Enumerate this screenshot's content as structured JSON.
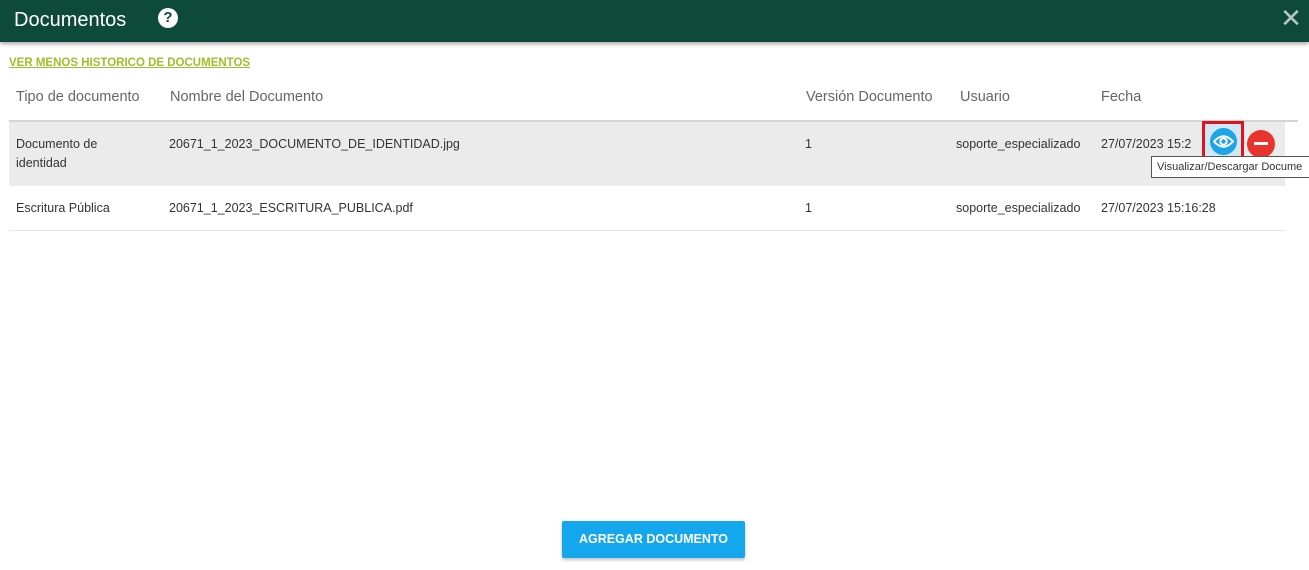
{
  "header": {
    "title": "Documentos",
    "help_icon": "?",
    "close_icon": "✕"
  },
  "history_link": "VER MENOS HISTORICO DE DOCUMENTOS",
  "table": {
    "columns": [
      "Tipo de documento",
      "Nombre del Documento",
      "Versión Documento",
      "Usuario",
      "Fecha"
    ],
    "rows": [
      {
        "tipo": "Documento de identidad",
        "nombre": "20671_1_2023_DOCUMENTO_DE_IDENTIDAD.jpg",
        "version": "1",
        "usuario": "soporte_especializado",
        "fecha": "27/07/2023 15:2"
      },
      {
        "tipo": "Escritura Pública",
        "nombre": "20671_1_2023_ESCRITURA_PUBLICA.pdf",
        "version": "1",
        "usuario": "soporte_especializado",
        "fecha": "27/07/2023 15:16:28"
      }
    ]
  },
  "tooltip": "Visualizar/Descargar Docume",
  "add_button": "AGREGAR DOCUMENTO",
  "colors": {
    "header_bg": "#0d4a3a",
    "link": "#9cc02a",
    "primary": "#14a7ee",
    "danger": "#e8342c",
    "highlight_border": "#e0121b"
  }
}
